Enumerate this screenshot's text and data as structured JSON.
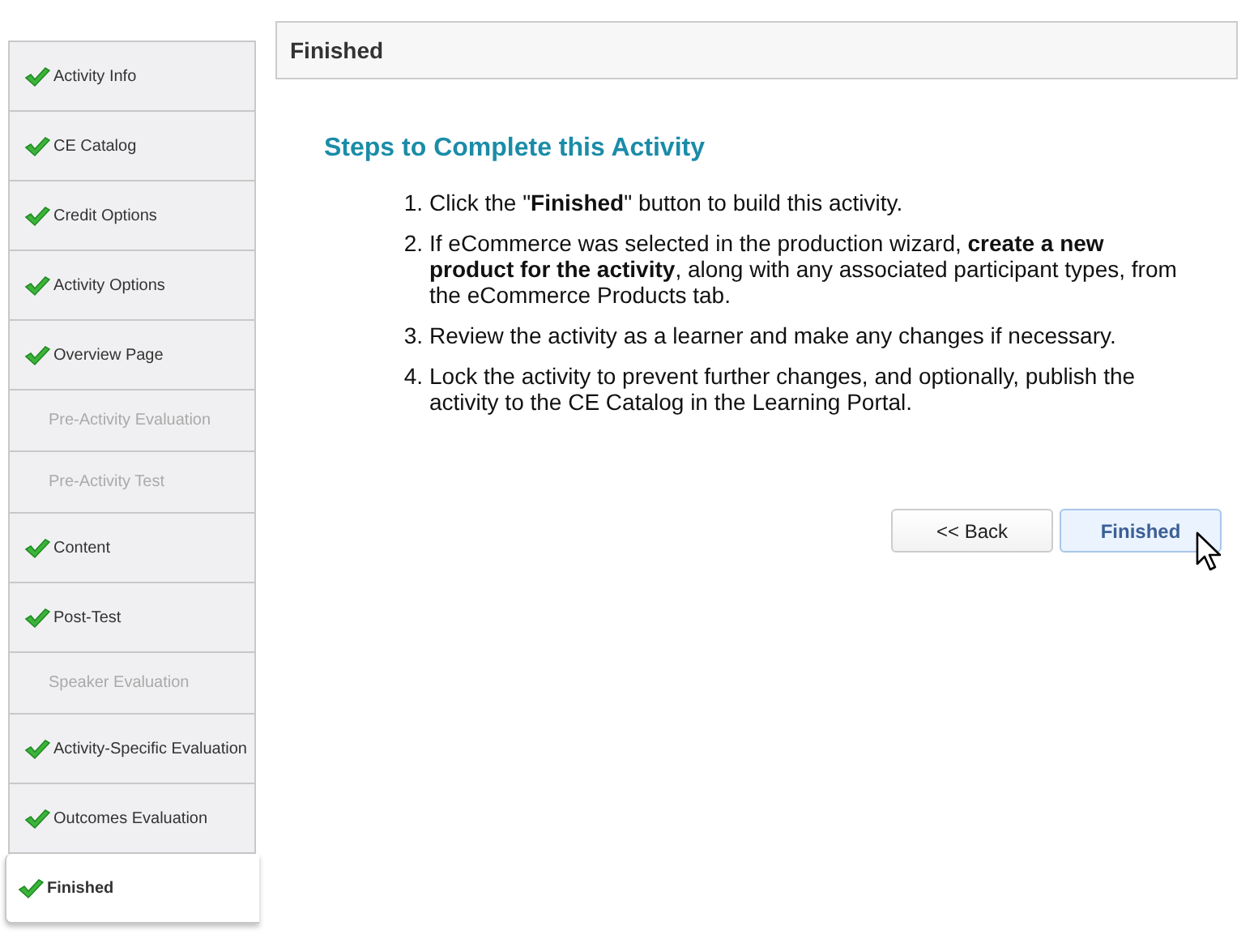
{
  "steps_nav": [
    {
      "label": "Activity Info",
      "completed": true,
      "selected": false
    },
    {
      "label": "CE Catalog",
      "completed": true,
      "selected": false
    },
    {
      "label": "Credit Options",
      "completed": true,
      "selected": false
    },
    {
      "label": "Activity Options",
      "completed": true,
      "selected": false
    },
    {
      "label": "Overview Page",
      "completed": true,
      "selected": false
    },
    {
      "label": "Pre-Activity Evaluation",
      "completed": false,
      "selected": false
    },
    {
      "label": "Pre-Activity Test",
      "completed": false,
      "selected": false
    },
    {
      "label": "Content",
      "completed": true,
      "selected": false
    },
    {
      "label": "Post-Test",
      "completed": true,
      "selected": false
    },
    {
      "label": "Speaker Evaluation",
      "completed": false,
      "selected": false
    },
    {
      "label": "Activity-Specific Evaluation",
      "completed": true,
      "selected": false
    },
    {
      "label": "Outcomes Evaluation",
      "completed": true,
      "selected": false
    },
    {
      "label": "Finished",
      "completed": true,
      "selected": true
    }
  ],
  "panel": {
    "title": "Finished",
    "heading": "Steps to Complete this Activity",
    "steps": [
      {
        "number": "1.",
        "text": "Click the \"**Finished**\" button to build this activity."
      },
      {
        "number": "2.",
        "text": "If eCommerce was selected in the production wizard, **create a new product for the activity**, along with any associated participant types, from the eCommerce Products tab."
      },
      {
        "number": "3.",
        "text": "Review the activity as a learner and make any changes if necessary."
      },
      {
        "number": "4.",
        "text": "Lock the activity to prevent further changes, and optionally, publish the activity to the CE Catalog in the Learning Portal."
      }
    ],
    "buttons": [
      {
        "label": "<< Back",
        "kind": "secondary"
      },
      {
        "label": "Finished",
        "kind": "primary",
        "hovered": true
      }
    ]
  }
}
